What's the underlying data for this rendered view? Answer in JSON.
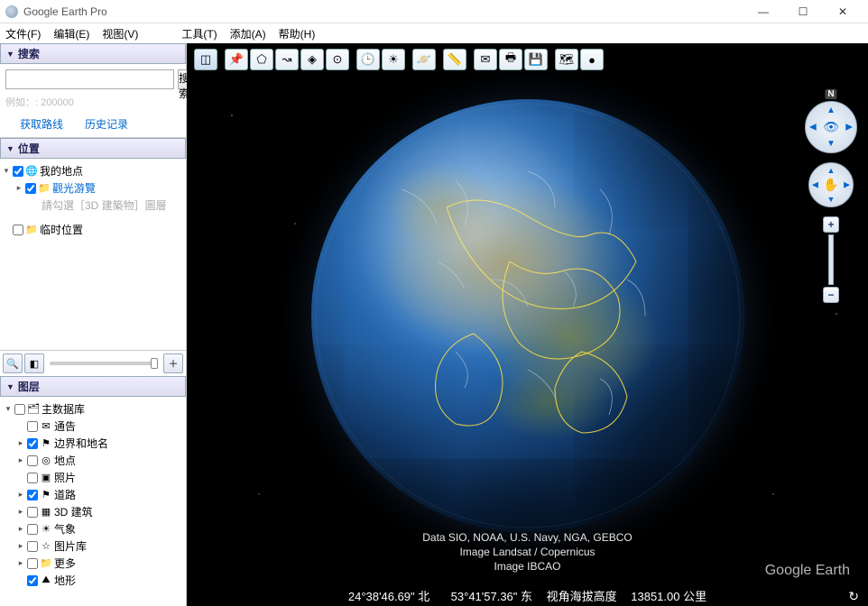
{
  "window": {
    "title": "Google Earth Pro"
  },
  "menu": {
    "file": "文件(F)",
    "edit": "编辑(E)",
    "view": "视图(V)",
    "tools": "工具(T)",
    "add": "添加(A)",
    "help": "帮助(H)"
  },
  "search": {
    "header": "搜索",
    "button": "搜索",
    "hint": "例如：: 200000",
    "route": "获取路线",
    "history": "历史记录"
  },
  "places": {
    "header": "位置",
    "myplaces": "我的地点",
    "sightseeing": "觀光游覽",
    "sightseeing_hint": "請勾選［3D 建築物］圖層",
    "temp": "临时位置"
  },
  "layers": {
    "header": "图层",
    "primary_db": "主数据库",
    "items": [
      {
        "label": "通告",
        "checked": false
      },
      {
        "label": "边界和地名",
        "checked": true,
        "expandable": true
      },
      {
        "label": "地点",
        "checked": false,
        "expandable": true
      },
      {
        "label": "照片",
        "checked": false
      },
      {
        "label": "道路",
        "checked": true,
        "expandable": true
      },
      {
        "label": "3D 建筑",
        "checked": false,
        "expandable": true
      },
      {
        "label": "气象",
        "checked": false,
        "expandable": true
      },
      {
        "label": "图片库",
        "checked": false,
        "expandable": true
      },
      {
        "label": "更多",
        "checked": false,
        "expandable": true
      },
      {
        "label": "地形",
        "checked": true
      }
    ]
  },
  "attribution": {
    "line1": "Data SIO, NOAA, U.S. Navy, NGA, GEBCO",
    "line2": "Image Landsat / Copernicus",
    "line3": "Image IBCAO"
  },
  "watermark": "Google Earth",
  "status": {
    "lat": "24°38'46.69\" 北",
    "lon": "53°41'57.36\" 东",
    "alt_label": "视角海拔高度",
    "alt_value": "13851.00 公里"
  },
  "compass": {
    "n": "N"
  }
}
